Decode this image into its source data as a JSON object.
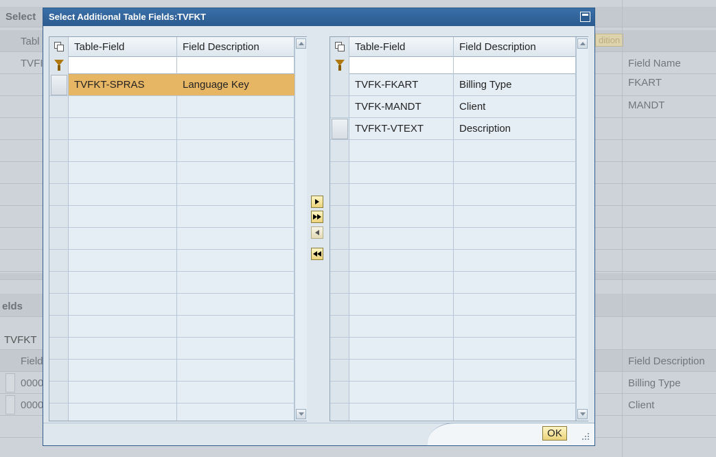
{
  "background": {
    "title_fragment": "Select",
    "header_fragment": "Tabl",
    "value_fragment": "TVFI",
    "button_fragment": "dition",
    "right_col_header": "Field Name",
    "right_values": [
      "FKART",
      "MANDT"
    ],
    "section_title": "elds",
    "section_tab": "TVFKT",
    "lower_header_fragment": "Field",
    "lower_right_header": "Field Description",
    "lower_values": [
      "0000",
      "0000"
    ],
    "lower_right_values": [
      "Billing Type",
      "Client"
    ]
  },
  "dialog": {
    "title": "Select Additional Table Fields:TVFKT",
    "left_table": {
      "col_table_field": "Table-Field",
      "col_field_description": "Field Description",
      "rows": [
        {
          "field": "TVFKT-SPRAS",
          "description": "Language Key",
          "selected": true
        }
      ]
    },
    "right_table": {
      "col_table_field": "Table-Field",
      "col_field_description": "Field Description",
      "rows": [
        {
          "field": "TVFK-FKART",
          "description": "Billing Type"
        },
        {
          "field": "TVFK-MANDT",
          "description": "Client"
        },
        {
          "field": "TVFKT-VTEXT",
          "description": "Description"
        }
      ]
    },
    "ok_label": "OK"
  },
  "colors": {
    "title_bar": "#2b5b8f",
    "selection": "#e7b664",
    "button": "#ecd47c"
  },
  "icons": [
    "column-settings-icon",
    "filter-icon",
    "move-right-icon",
    "move-all-right-icon",
    "move-left-icon",
    "move-all-left-icon",
    "restore-window-icon",
    "resize-grip-icon"
  ]
}
